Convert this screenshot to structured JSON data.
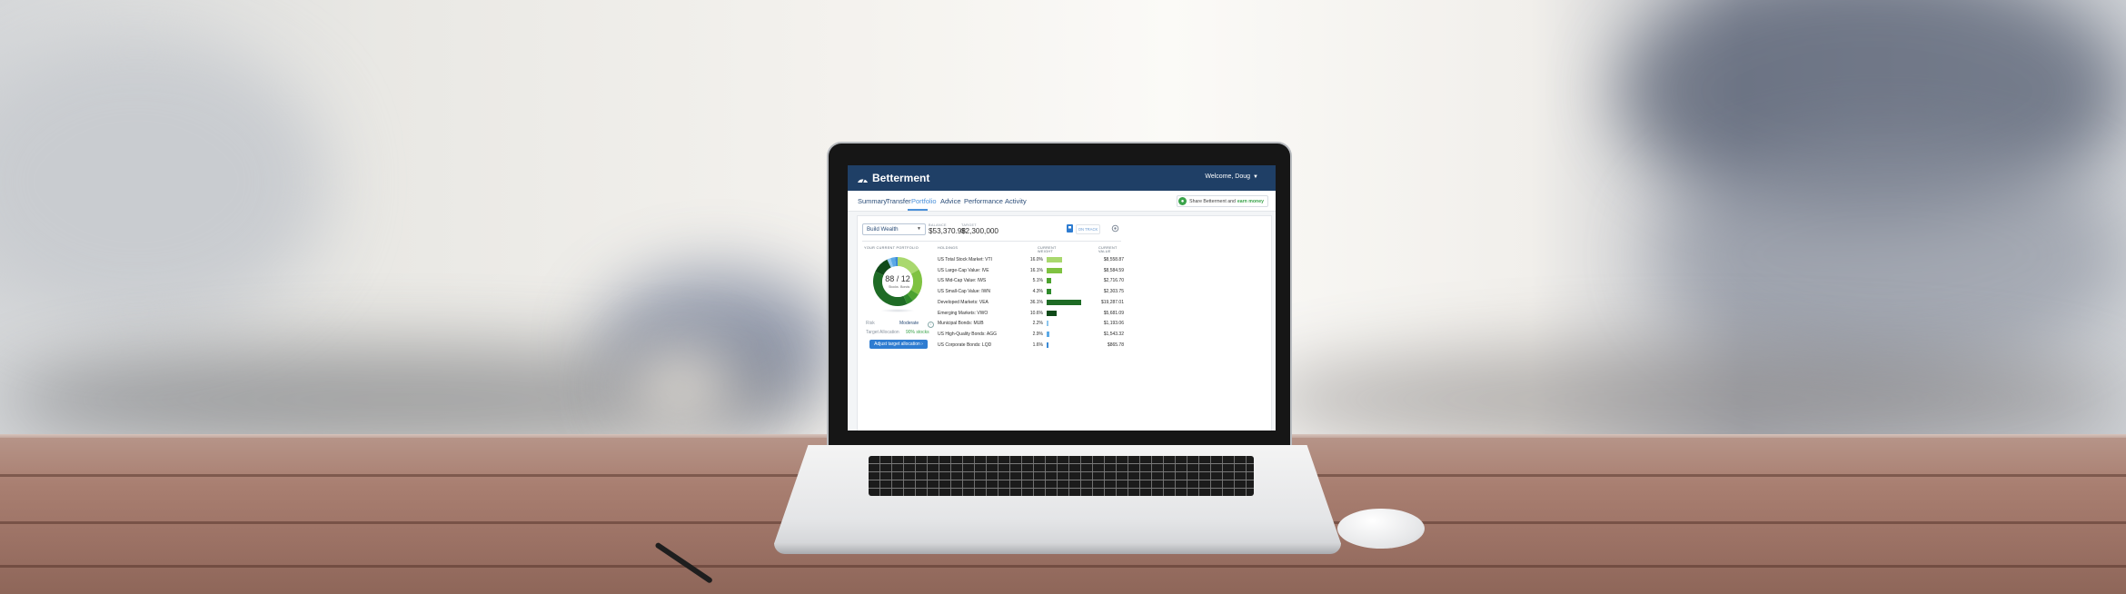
{
  "app": {
    "logo": "Betterment",
    "welcome": "Welcome, Doug"
  },
  "nav": {
    "tabs": [
      "Summary",
      "Transfer",
      "Portfolio",
      "Advice",
      "Performance",
      "Activity"
    ],
    "active": "Portfolio",
    "share_text": "Share Betterment and",
    "share_cta": "earn money"
  },
  "goal": {
    "selected": "Build Wealth",
    "balance_label": "BALANCE",
    "balance": "$53,370.98",
    "target_label": "TARGET",
    "target": "$2,300,000",
    "status": "ON TRACK"
  },
  "portfolio": {
    "section_label": "YOUR CURRENT PORTFOLIO",
    "donut_text": "88 / 12",
    "stocks_label": "Stocks",
    "bonds_label": "Bonds",
    "stocks_pct": 88,
    "bonds_pct": 12,
    "risk_label": "Risk",
    "risk_value": "Moderate",
    "target_label": "Target Allocation",
    "target_value": "90% stocks",
    "adjust_button": "Adjust target allocation ›"
  },
  "holdings": {
    "headers": {
      "name": "HOLDINGS",
      "weight": "CURRENT WEIGHT",
      "value": "CURRENT VALUE"
    },
    "rows": [
      {
        "name": "US Total Stock Market: VTI",
        "weight": "16.0%",
        "weight_num": 16.0,
        "value": "$8,558.87",
        "color": "#a9d86e"
      },
      {
        "name": "US Large-Cap Value: IVE",
        "weight": "16.1%",
        "weight_num": 16.1,
        "value": "$8,584.59",
        "color": "#7fc241"
      },
      {
        "name": "US Mid-Cap Value: IWS",
        "weight": "5.1%",
        "weight_num": 5.1,
        "value": "$2,716.70",
        "color": "#4da22f"
      },
      {
        "name": "US Small-Cap Value: IWN",
        "weight": "4.3%",
        "weight_num": 4.3,
        "value": "$2,303.75",
        "color": "#2f8a2c"
      },
      {
        "name": "Developed Markets: VEA",
        "weight": "36.1%",
        "weight_num": 36.1,
        "value": "$19,287.01",
        "color": "#1e6b25"
      },
      {
        "name": "Emerging Markets: VWO",
        "weight": "10.6%",
        "weight_num": 10.6,
        "value": "$5,681.09",
        "color": "#0f4a18"
      },
      {
        "name": "Municipal Bonds: MUB",
        "weight": "2.2%",
        "weight_num": 2.2,
        "value": "$1,193.06",
        "color": "#8dc6ee"
      },
      {
        "name": "US High-Quality Bonds: AGG",
        "weight": "2.9%",
        "weight_num": 2.9,
        "value": "$1,543.32",
        "color": "#5aa9e6"
      },
      {
        "name": "US Corporate Bonds: LQD",
        "weight": "1.6%",
        "weight_num": 1.6,
        "value": "$865.78",
        "color": "#3a8ad6"
      }
    ]
  },
  "colors": {
    "brand_nav": "#1f3f66",
    "accent_blue": "#2e7cd1",
    "accent_green": "#3aa34a"
  }
}
